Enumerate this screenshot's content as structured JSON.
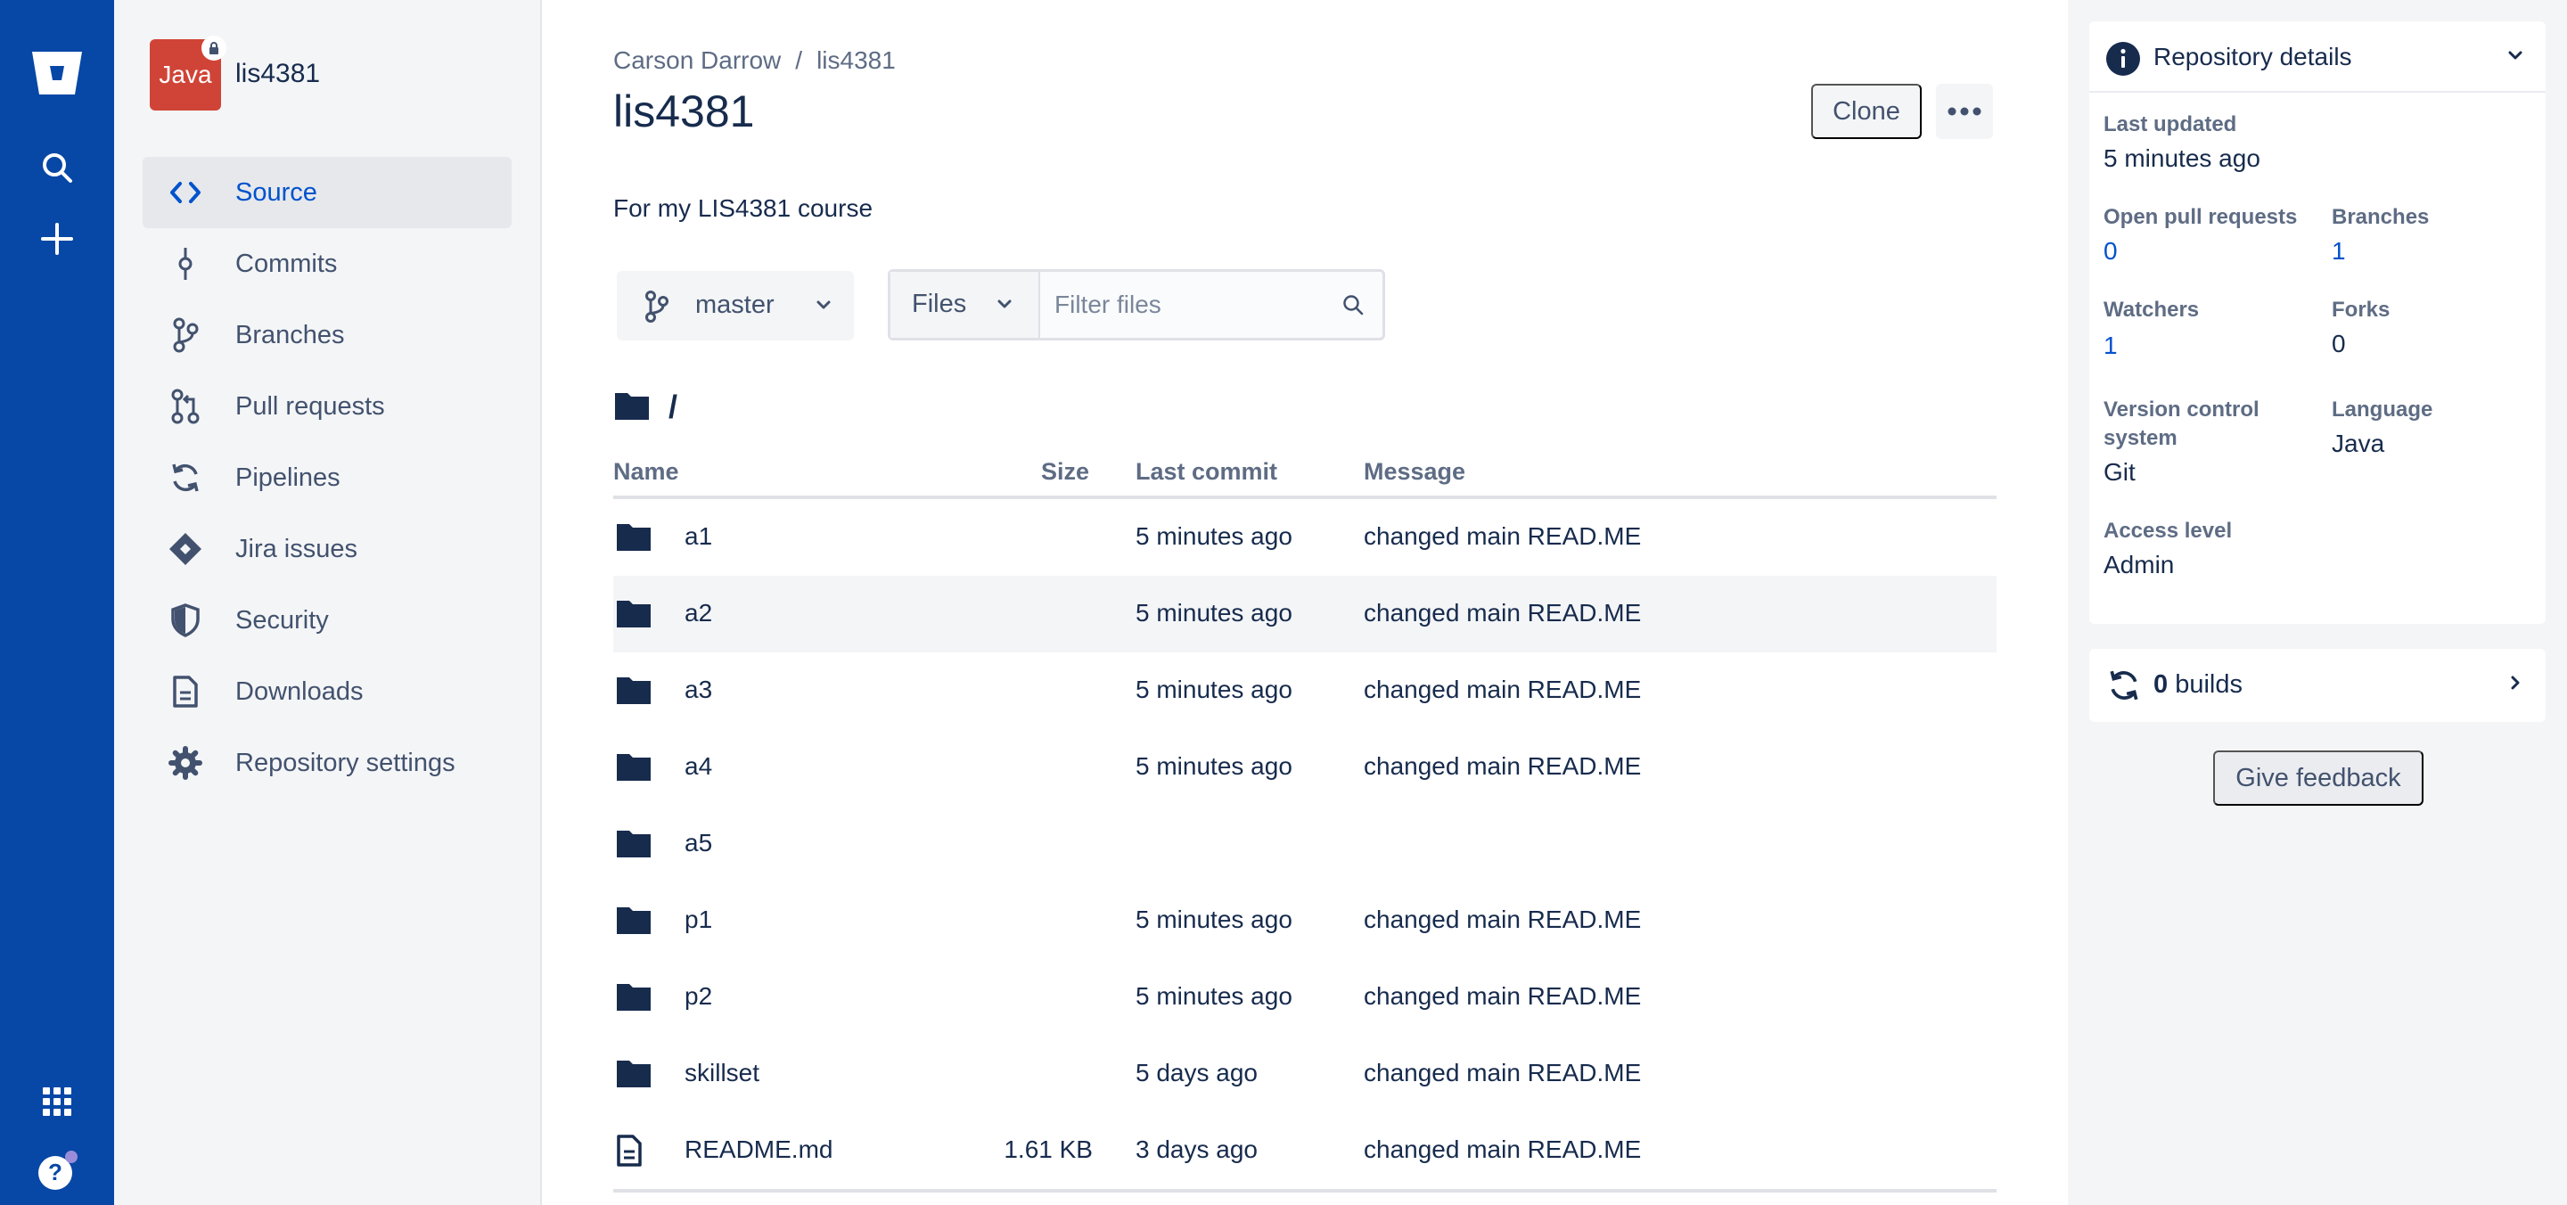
{
  "colors": {
    "global_nav": "#0747a6",
    "link": "#0052cc",
    "text": "#172b4d",
    "muted": "#5e6c84",
    "avatar": "#d04437"
  },
  "project": {
    "avatar_text": "Java",
    "name": "lis4381"
  },
  "sidebar": {
    "items": [
      {
        "label": "Source",
        "icon": "code-icon",
        "active": true
      },
      {
        "label": "Commits",
        "icon": "commit-icon"
      },
      {
        "label": "Branches",
        "icon": "branch-icon"
      },
      {
        "label": "Pull requests",
        "icon": "pull-request-icon"
      },
      {
        "label": "Pipelines",
        "icon": "pipelines-icon"
      },
      {
        "label": "Jira issues",
        "icon": "jira-icon"
      },
      {
        "label": "Security",
        "icon": "shield-icon"
      },
      {
        "label": "Downloads",
        "icon": "document-icon"
      },
      {
        "label": "Repository settings",
        "icon": "gear-icon"
      }
    ]
  },
  "breadcrumb": {
    "owner": "Carson Darrow",
    "separator": "/",
    "repo": "lis4381"
  },
  "header": {
    "title": "lis4381",
    "clone_label": "Clone"
  },
  "description": "For my LIS4381 course",
  "branch_selector": {
    "label": "master"
  },
  "filter": {
    "mode": "Files",
    "placeholder": "Filter files"
  },
  "path": "/",
  "table": {
    "columns": {
      "name": "Name",
      "size": "Size",
      "last_commit": "Last commit",
      "message": "Message"
    },
    "rows": [
      {
        "name": "a1",
        "type": "folder",
        "size": "",
        "last_commit": "5 minutes ago",
        "message": "changed main READ.ME"
      },
      {
        "name": "a2",
        "type": "folder",
        "size": "",
        "last_commit": "5 minutes ago",
        "message": "changed main READ.ME"
      },
      {
        "name": "a3",
        "type": "folder",
        "size": "",
        "last_commit": "5 minutes ago",
        "message": "changed main READ.ME"
      },
      {
        "name": "a4",
        "type": "folder",
        "size": "",
        "last_commit": "5 minutes ago",
        "message": "changed main READ.ME"
      },
      {
        "name": "a5",
        "type": "folder",
        "size": "",
        "last_commit": "",
        "message": ""
      },
      {
        "name": "p1",
        "type": "folder",
        "size": "",
        "last_commit": "5 minutes ago",
        "message": "changed main READ.ME"
      },
      {
        "name": "p2",
        "type": "folder",
        "size": "",
        "last_commit": "5 minutes ago",
        "message": "changed main READ.ME"
      },
      {
        "name": "skillset",
        "type": "folder",
        "size": "",
        "last_commit": "5 days ago",
        "message": "changed main READ.ME"
      },
      {
        "name": "README.md",
        "type": "file",
        "size": "1.61 KB",
        "last_commit": "3 days ago",
        "message": "changed main READ.ME"
      }
    ]
  },
  "details": {
    "title": "Repository details",
    "last_updated_label": "Last updated",
    "last_updated_value": "5 minutes ago",
    "open_prs_label": "Open pull requests",
    "open_prs_value": "0",
    "branches_label": "Branches",
    "branches_value": "1",
    "watchers_label": "Watchers",
    "watchers_value": "1",
    "forks_label": "Forks",
    "forks_value": "0",
    "vcs_label_line1": "Version control",
    "vcs_label_line2": "system",
    "vcs_value": "Git",
    "language_label": "Language",
    "language_value": "Java",
    "access_label": "Access level",
    "access_value": "Admin"
  },
  "builds": {
    "count": "0",
    "label": "builds"
  },
  "feedback_label": "Give feedback"
}
